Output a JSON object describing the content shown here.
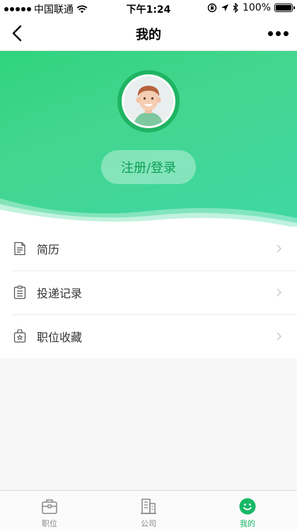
{
  "status_bar": {
    "carrier": "中国联通",
    "time": "下午1:24",
    "battery": "100%"
  },
  "nav": {
    "title": "我的"
  },
  "profile": {
    "login_label": "注册/登录"
  },
  "menu": {
    "items": [
      {
        "label": "简历",
        "icon": "resume-icon"
      },
      {
        "label": "投递记录",
        "icon": "delivery-record-icon"
      },
      {
        "label": "职位收藏",
        "icon": "favorites-icon"
      }
    ]
  },
  "tabs": [
    {
      "label": "职位",
      "icon": "briefcase-icon",
      "active": false
    },
    {
      "label": "公司",
      "icon": "building-icon",
      "active": false
    },
    {
      "label": "我的",
      "icon": "smile-icon",
      "active": true
    }
  ],
  "colors": {
    "accent": "#18b867",
    "header_gradient_start": "#2fd37e",
    "header_gradient_end": "#3fd7a6"
  }
}
